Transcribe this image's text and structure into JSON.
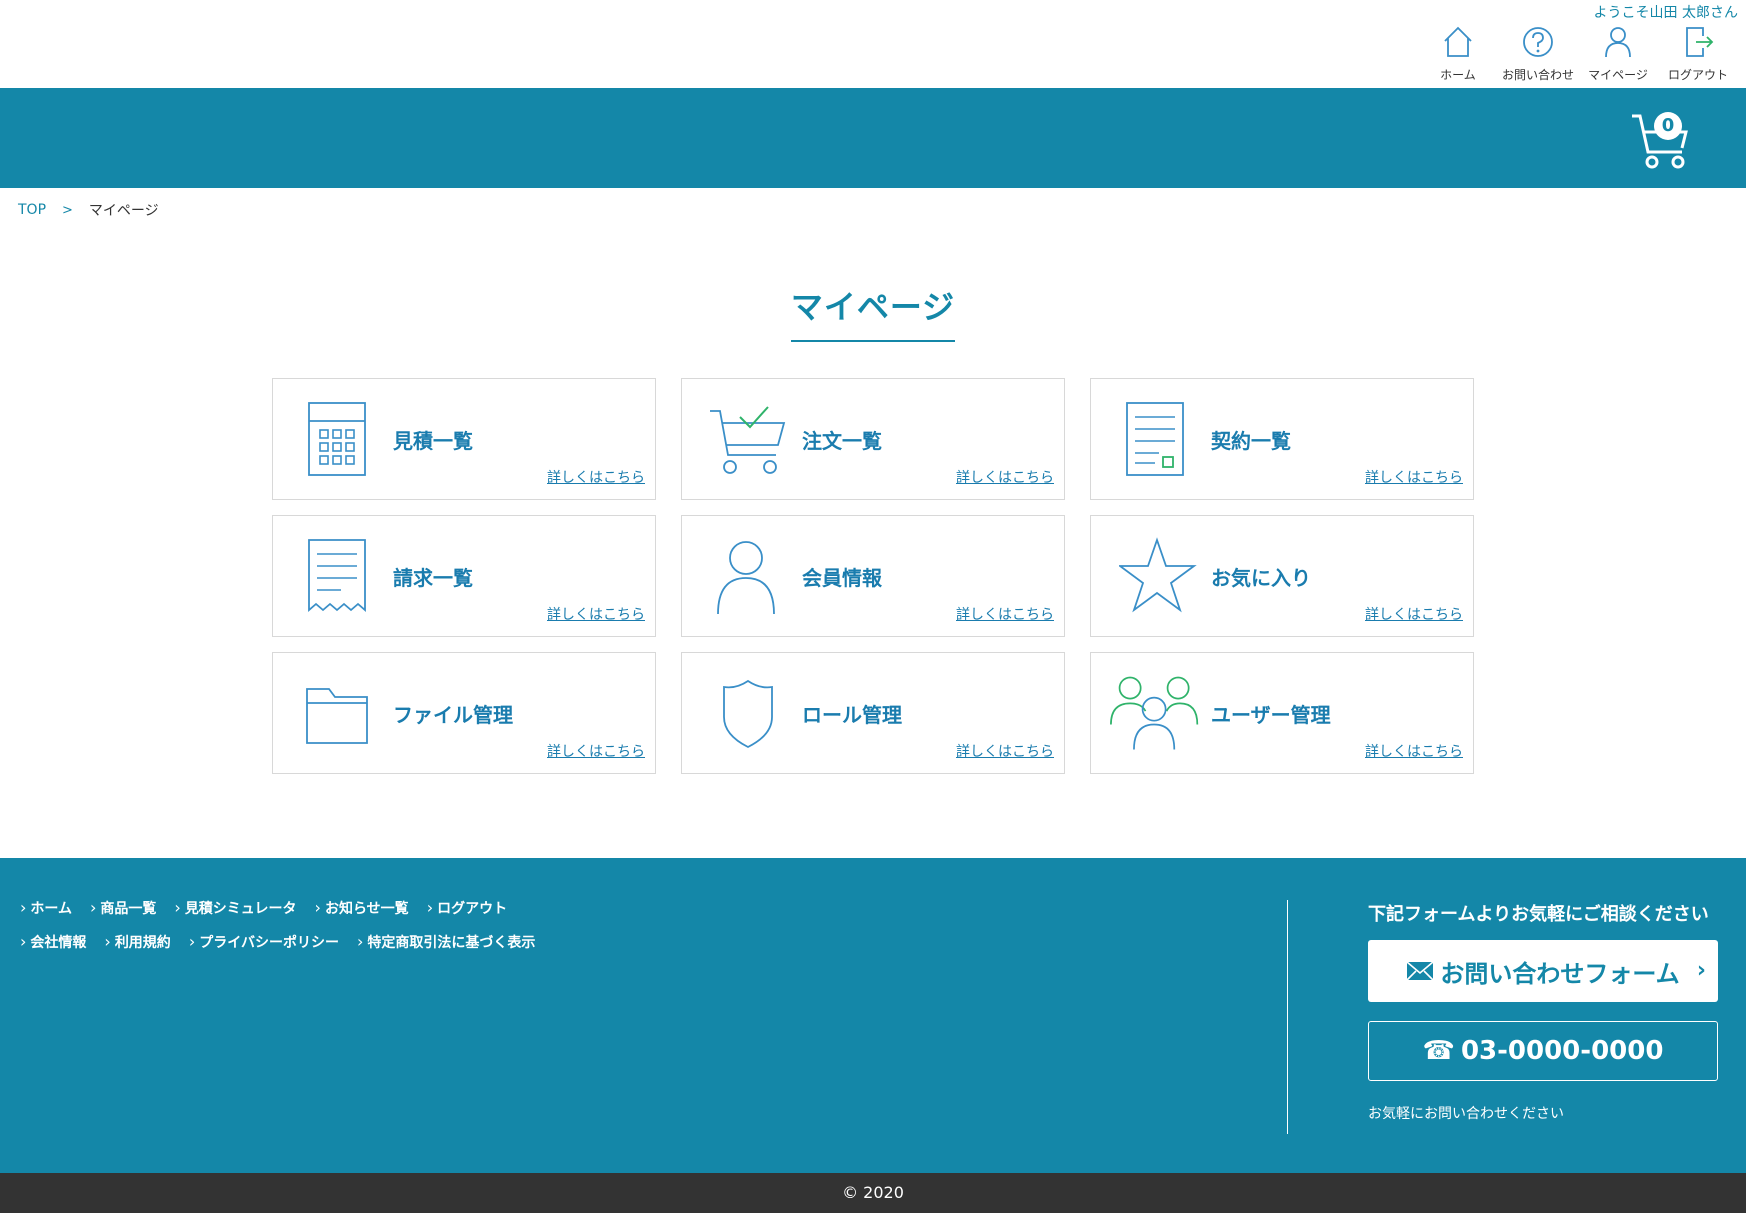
{
  "header": {
    "welcome": "ようこそ山田 太郎さん",
    "nav": [
      {
        "label": "ホーム",
        "icon": "home-icon"
      },
      {
        "label": "お問い合わせ",
        "icon": "help-icon"
      },
      {
        "label": "マイページ",
        "icon": "user-icon"
      },
      {
        "label": "ログアウト",
        "icon": "logout-icon"
      }
    ],
    "cart_count": "0"
  },
  "breadcrumb": {
    "top": "TOP",
    "separator": ">",
    "current": "マイページ"
  },
  "page": {
    "title": "マイページ"
  },
  "cards": [
    {
      "title": "見積一覧",
      "link": "詳しくはこちら",
      "icon": "calculator-icon"
    },
    {
      "title": "注文一覧",
      "link": "詳しくはこちら",
      "icon": "cart-check-icon"
    },
    {
      "title": "契約一覧",
      "link": "詳しくはこちら",
      "icon": "contract-icon"
    },
    {
      "title": "請求一覧",
      "link": "詳しくはこちら",
      "icon": "receipt-icon"
    },
    {
      "title": "会員情報",
      "link": "詳しくはこちら",
      "icon": "person-icon"
    },
    {
      "title": "お気に入り",
      "link": "詳しくはこちら",
      "icon": "star-icon"
    },
    {
      "title": "ファイル管理",
      "link": "詳しくはこちら",
      "icon": "folder-icon"
    },
    {
      "title": "ロール管理",
      "link": "詳しくはこちら",
      "icon": "shield-icon"
    },
    {
      "title": "ユーザー管理",
      "link": "詳しくはこちら",
      "icon": "users-icon"
    }
  ],
  "footer": {
    "links_row1": [
      "ホーム",
      "商品一覧",
      "見積シミュレータ",
      "お知らせ一覧",
      "ログアウト"
    ],
    "links_row2": [
      "会社情報",
      "利用規約",
      "プライバシーポリシー",
      "特定商取引法に基づく表示"
    ],
    "contact_heading": "下記フォームよりお気軽にご相談ください",
    "contact_form_label": "お問い合わせフォーム",
    "phone": "03-0000-0000",
    "contact_note": "お気軽にお問い合わせください",
    "copyright": "© 2020"
  },
  "colors": {
    "primary": "#1487a8",
    "icon_blue": "#3a8fc8",
    "accent_green": "#2fb36a",
    "copyright_bg": "#333333"
  }
}
